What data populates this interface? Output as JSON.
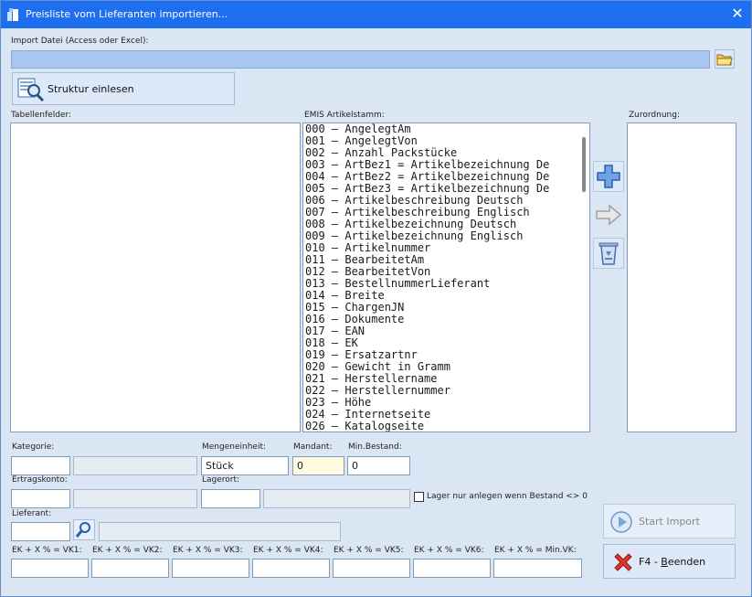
{
  "window": {
    "title": "Preisliste vom Lieferanten importieren...",
    "close_glyph": "✕"
  },
  "import": {
    "label": "Import Datei (Access oder Excel):",
    "path_value": ""
  },
  "struktur_button": {
    "label": "Struktur einlesen"
  },
  "tabellenfelder": {
    "label": "Tabellenfelder:"
  },
  "emis": {
    "label": "EMIS Artikelstamm:",
    "items": [
      "000 – AngelegtAm",
      "001 – AngelegtVon",
      "002 – Anzahl Packstücke",
      "003 – ArtBez1 = Artikelbezeichnung De",
      "004 – ArtBez2 = Artikelbezeichnung De",
      "005 – ArtBez3 = Artikelbezeichnung De",
      "006 – Artikelbeschreibung Deutsch",
      "007 – Artikelbeschreibung Englisch",
      "008 – Artikelbezeichnung Deutsch",
      "009 – Artikelbezeichnung Englisch",
      "010 – Artikelnummer",
      "011 – BearbeitetAm",
      "012 – BearbeitetVon",
      "013 – BestellnummerLieferant",
      "014 – Breite",
      "015 – ChargenJN",
      "016 – Dokumente",
      "017 – EAN",
      "018 – EK",
      "019 – Ersatzartnr",
      "020 – Gewicht in Gramm",
      "021 – Herstellername",
      "022 – Herstellernummer",
      "023 – Höhe",
      "024 – Internetseite",
      "026 – Katalogseite"
    ]
  },
  "zuordnung": {
    "label": "Zurordnung:"
  },
  "form": {
    "kategorie": {
      "label": "Kategorie:",
      "value": "",
      "desc": ""
    },
    "mengeneinheit": {
      "label": "Mengeneinheit:",
      "value": "Stück"
    },
    "mandant": {
      "label": "Mandant:",
      "value": "0"
    },
    "min_bestand": {
      "label": "Min.Bestand:",
      "value": "0"
    },
    "ertragskonto": {
      "label": "Ertragskonto:",
      "value": "",
      "desc": ""
    },
    "lagerort": {
      "label": "Lagerort:",
      "value": "",
      "desc": ""
    },
    "lager_checkbox": {
      "label": "Lager nur anlegen wenn Bestand <> 0",
      "checked": false
    },
    "lieferant": {
      "label": "Lieferant:",
      "value": "",
      "desc": ""
    },
    "vk": [
      {
        "label": "EK + X % = VK1:",
        "value": ""
      },
      {
        "label": "EK + X % = VK2:",
        "value": ""
      },
      {
        "label": "EK + X % = VK3:",
        "value": ""
      },
      {
        "label": "EK + X % = VK4:",
        "value": ""
      },
      {
        "label": "EK + X % = VK5:",
        "value": ""
      },
      {
        "label": "EK + X % = VK6:",
        "value": ""
      },
      {
        "label": "EK + X % = Min.VK:",
        "value": ""
      }
    ]
  },
  "buttons": {
    "start_import": "Start Import",
    "beenden_prefix": "F4 - ",
    "beenden_accel": "B",
    "beenden_rest": "eenden"
  },
  "colors": {
    "titlebar": "#1e6ff0",
    "window_bg": "#dbe6f4",
    "path_field": "#a9c6ee",
    "mandant_bg": "#fffbe0"
  }
}
